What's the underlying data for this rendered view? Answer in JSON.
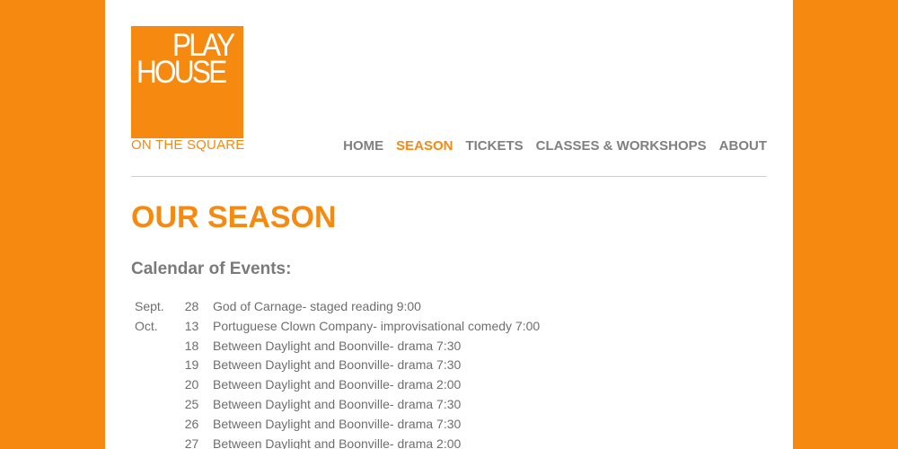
{
  "logo": {
    "line1": "PLAY",
    "line2": "HOUSE",
    "subtitle": "ON THE SQUARE"
  },
  "nav": {
    "items": [
      {
        "label": "HOME"
      },
      {
        "label": "SEASON"
      },
      {
        "label": "TICKETS"
      },
      {
        "label": "CLASSES & WORKSHOPS"
      },
      {
        "label": "ABOUT"
      }
    ],
    "active": "SEASON"
  },
  "page_title": "OUR SEASON",
  "subheading": "Calendar of Events:",
  "events": [
    {
      "month": "Sept.",
      "day": "28",
      "desc": "God of Carnage- staged reading 9:00"
    },
    {
      "month": "Oct.",
      "day": "13",
      "desc": "Portuguese Clown Company- improvisational comedy 7:00"
    },
    {
      "month": "",
      "day": "18",
      "desc": "Between Daylight and Boonville- drama 7:30"
    },
    {
      "month": "",
      "day": "19",
      "desc": "Between Daylight and Boonville- drama 7:30"
    },
    {
      "month": "",
      "day": "20",
      "desc": "Between Daylight and Boonville- drama 2:00"
    },
    {
      "month": "",
      "day": "25",
      "desc": "Between Daylight and Boonville- drama 7:30"
    },
    {
      "month": "",
      "day": "26",
      "desc": "Between Daylight and Boonville- drama 7:30"
    },
    {
      "month": "",
      "day": "27",
      "desc": "Between Daylight and Boonville- drama 2:00"
    }
  ],
  "colors": {
    "brand_orange": "#f6890f",
    "nav_gray": "#808080",
    "text_gray": "#6e6e6e"
  }
}
